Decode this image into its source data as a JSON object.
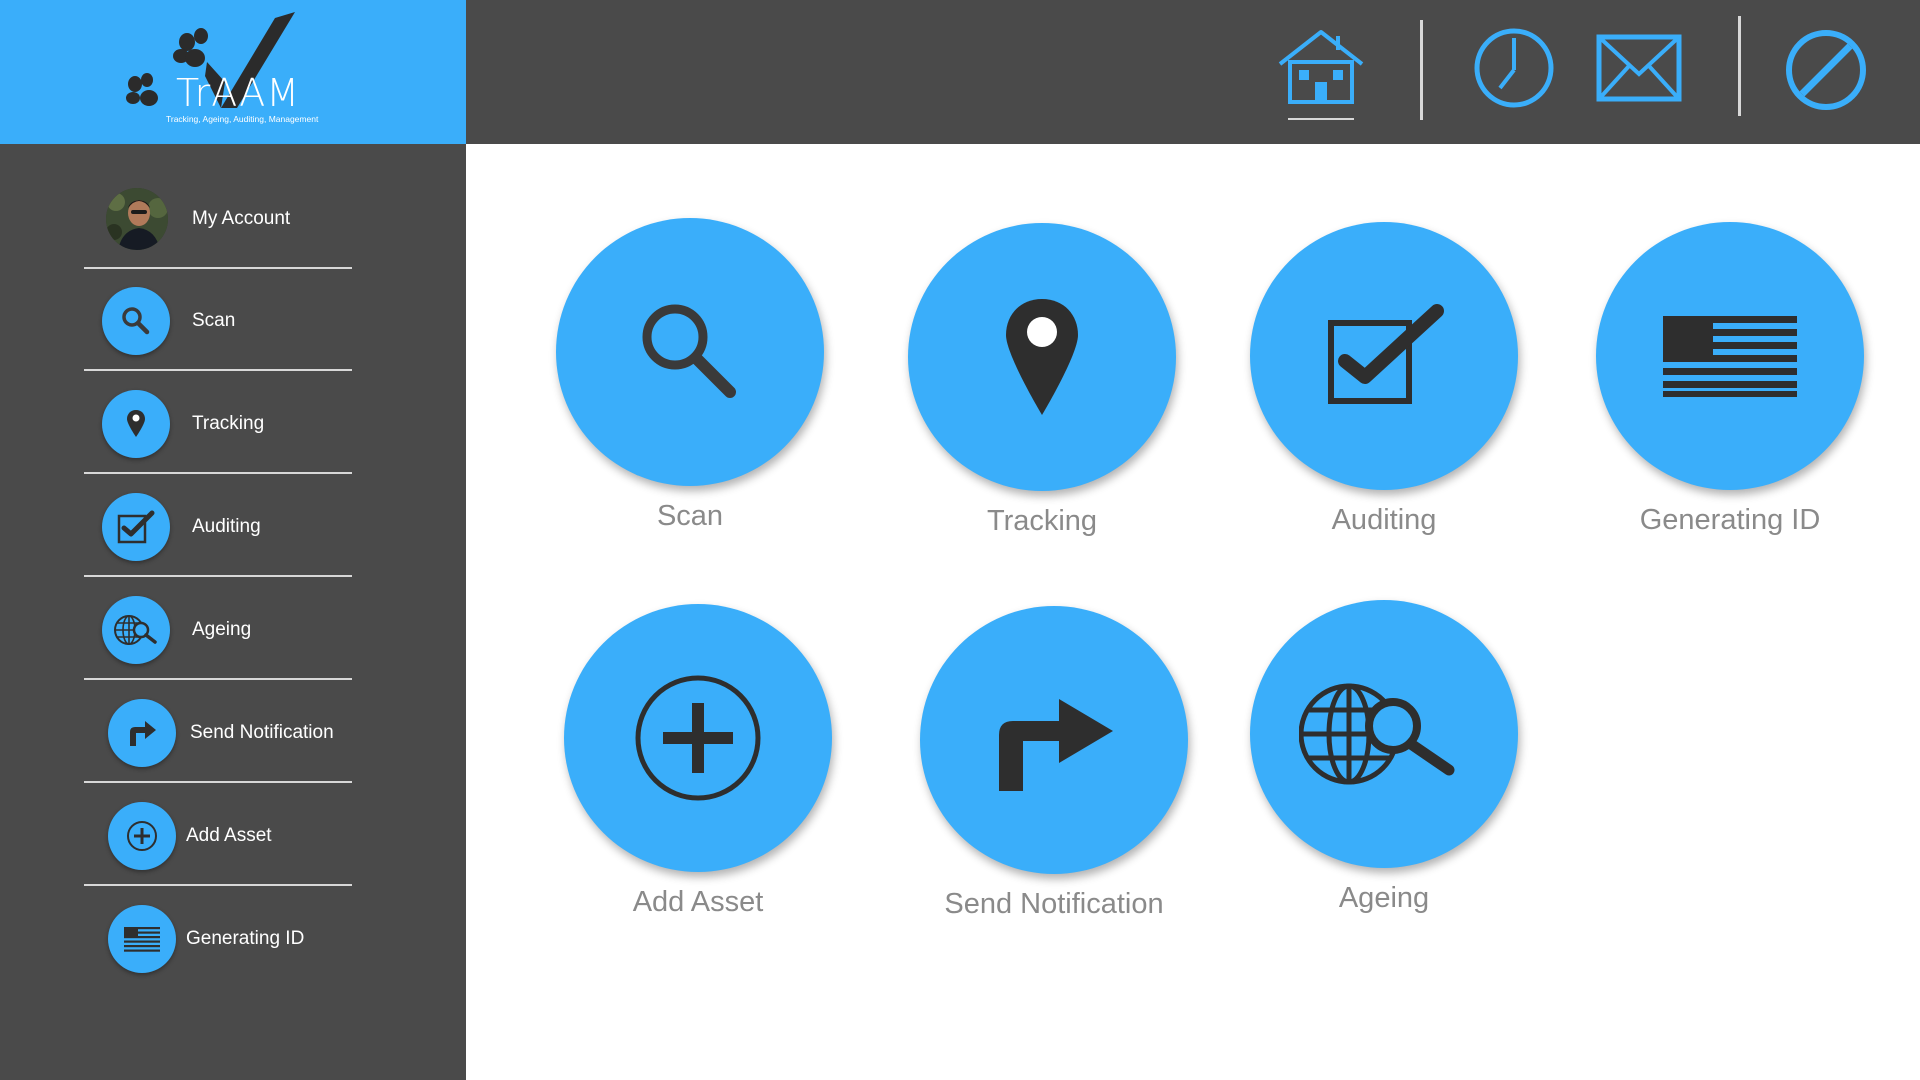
{
  "brand": {
    "name": "TrAAM",
    "tagline": "Tracking, Ageing, Auditing, Management"
  },
  "colors": {
    "accent": "#3aaefa",
    "dark": "#4a4a4a",
    "icon": "#3a3a3a",
    "tile_label": "#8a8a8a"
  },
  "topbar": {
    "icons": [
      "home-icon",
      "clock-icon",
      "mail-icon",
      "block-icon"
    ]
  },
  "sidebar": {
    "items": [
      {
        "label": "My Account",
        "icon": "avatar"
      },
      {
        "label": "Scan",
        "icon": "search-icon"
      },
      {
        "label": "Tracking",
        "icon": "map-pin-icon"
      },
      {
        "label": "Auditing",
        "icon": "checkbox-icon"
      },
      {
        "label": "Ageing",
        "icon": "globe-search-icon"
      },
      {
        "label": "Send Notification",
        "icon": "forward-arrow-icon"
      },
      {
        "label": "Add Asset",
        "icon": "plus-circle-icon"
      },
      {
        "label": "Generating ID",
        "icon": "flag-icon"
      }
    ]
  },
  "tiles": [
    {
      "label": "Scan",
      "icon": "search-icon"
    },
    {
      "label": "Tracking",
      "icon": "map-pin-icon"
    },
    {
      "label": "Auditing",
      "icon": "checkbox-icon"
    },
    {
      "label": "Generating ID",
      "icon": "flag-icon"
    },
    {
      "label": "Add Asset",
      "icon": "plus-circle-icon"
    },
    {
      "label": "Send Notification",
      "icon": "forward-arrow-icon"
    },
    {
      "label": "Ageing",
      "icon": "globe-search-icon"
    }
  ]
}
